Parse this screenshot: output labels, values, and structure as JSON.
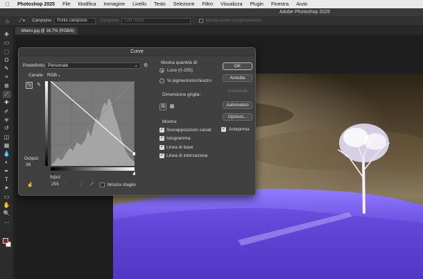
{
  "menubar": {
    "app_name": "Photoshop 2025",
    "items": [
      "File",
      "Modifica",
      "Immagine",
      "Livello",
      "Testo",
      "Selezione",
      "Filtro",
      "Visualizza",
      "Plugin",
      "Finestra",
      "Aiuto"
    ]
  },
  "window_title": "Adobe Photoshop 2025",
  "options_bar": {
    "sample_label": "Campione:",
    "sample_value": "Punto campione",
    "sample2_label": "Campione",
    "sample2_value": "Tutti i livelli",
    "ring_label": "Mostra anello campionamento"
  },
  "document_tab": "Albero.jpg @ 16,7% (RGB/8)",
  "tools": [
    "move-icon",
    "artboard-icon",
    "marquee-icon",
    "lasso-icon",
    "quick-select-icon",
    "crop-icon",
    "frame-icon",
    "eyedropper-icon",
    "healing-icon",
    "brush-icon",
    "clone-stamp-icon",
    "history-brush-icon",
    "eraser-icon",
    "gradient-icon",
    "blur-icon",
    "dodge-icon",
    "pen-icon",
    "type-icon",
    "path-select-icon",
    "rectangle-icon",
    "hand-icon",
    "zoom-icon",
    "more-icon"
  ],
  "tool_glyphs": [
    "✥",
    "▭",
    "⬚",
    "ʘ",
    "✎",
    "⌗",
    "⊠",
    "⟋",
    "✚",
    "✐",
    "⎈",
    "↺",
    "◫",
    "▦",
    "💧",
    "◐",
    "✒",
    "T",
    "➤",
    "▭",
    "✋",
    "🔍",
    "⋯"
  ],
  "curves": {
    "title": "Curve",
    "preset_label": "Predefinito:",
    "preset_value": "Personale",
    "channel_label": "Canale:",
    "channel_value": "RGB",
    "output_label": "Output:",
    "output_value": "36",
    "input_label": "Input:",
    "input_value": "255",
    "show_clipping_label": "Mostra ritaglio",
    "show_amount_title": "Mostra quantità di:",
    "light_option": "Luce (0-255)",
    "pigment_option": "% pigmento/inchiostro",
    "grid_size_title": "Dimensione griglia:",
    "show_title": "Mostra:",
    "show_options": [
      "Sovrapposizioni canali",
      "Istogramma",
      "Linea di base",
      "Linea di intersezione"
    ],
    "buttons": {
      "ok": "OK",
      "cancel": "Annulla",
      "smooth": "Arrotonda",
      "auto": "Automatico",
      "options": "Opzioni..."
    },
    "preview_label": "Anteprima"
  },
  "colors": {
    "foreground": "#8b1e1e",
    "background": "#ffffff",
    "accent": "#7a5cff"
  }
}
